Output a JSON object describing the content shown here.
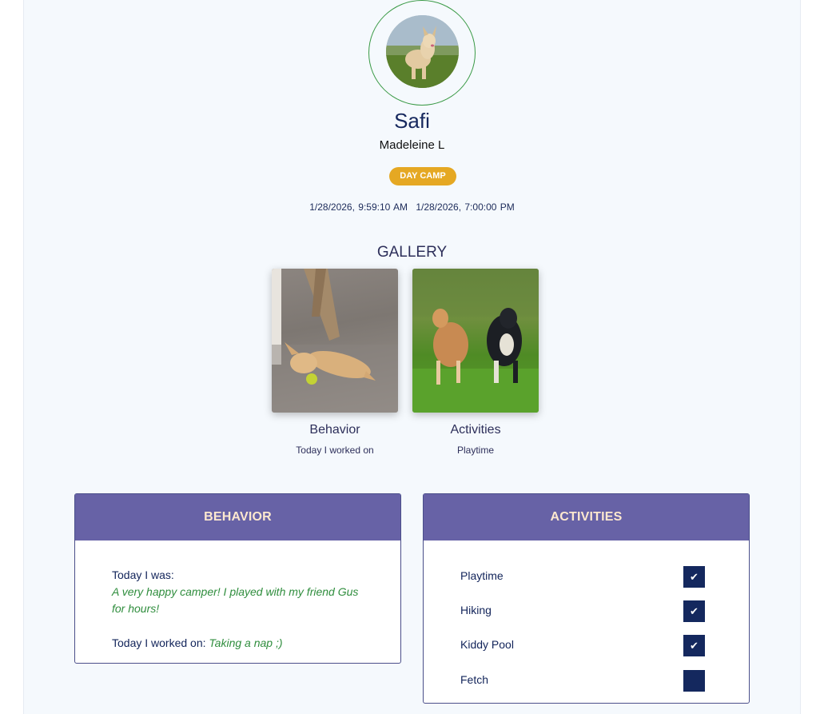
{
  "profile": {
    "pet_name": "Safi",
    "owner_name": "Madeleine L",
    "badge": "DAY CAMP",
    "check_in": "1/28/2026, 9:59:10 AM",
    "check_out": "1/28/2026, 7:00:00 PM",
    "accent_color": "#3a9a46",
    "badge_color": "#e5a823"
  },
  "gallery": {
    "title": "GALLERY",
    "items": [
      {
        "title": "Behavior",
        "subtitle": "Today I worked on"
      },
      {
        "title": "Activities",
        "subtitle": "Playtime"
      }
    ]
  },
  "behavior": {
    "header": "BEHAVIOR",
    "today_was_label": "Today I was:",
    "today_was_value": "A very happy camper! I played with my friend Gus for hours!",
    "worked_on_label": "Today I worked on:",
    "worked_on_value": "Taking a nap ;)",
    "header_color": "#6762a6"
  },
  "activities": {
    "header": "ACTIVITIES",
    "items": [
      {
        "label": "Playtime",
        "checked": true
      },
      {
        "label": "Hiking",
        "checked": true
      },
      {
        "label": "Kiddy Pool",
        "checked": true
      },
      {
        "label": "Fetch",
        "checked": false
      }
    ],
    "check_glyph": "✔"
  }
}
